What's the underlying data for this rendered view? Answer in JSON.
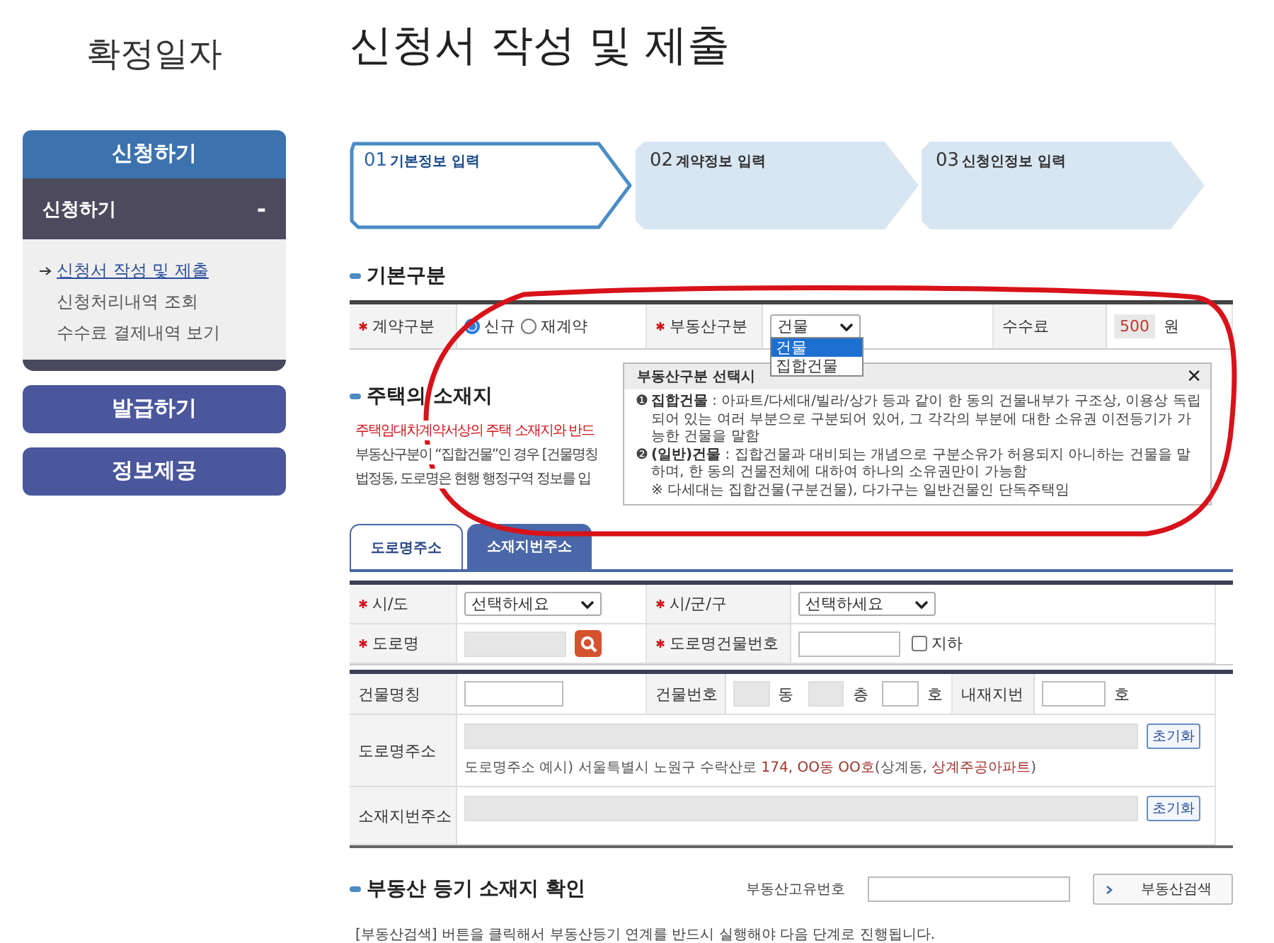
{
  "sidebar": {
    "title": "확정일자",
    "menus": [
      {
        "label": "신청하기",
        "selected": true,
        "expanded": true,
        "submenu": {
          "label": "신청하기",
          "toggle": "-",
          "items": [
            {
              "label": "신청서 작성 및 제출",
              "selected": true
            },
            {
              "label": "신청처리내역 조회",
              "selected": false
            },
            {
              "label": "수수료 결제내역 보기",
              "selected": false
            }
          ]
        }
      },
      {
        "label": "발급하기",
        "selected": false,
        "expanded": false
      },
      {
        "label": "정보제공",
        "selected": false,
        "expanded": false
      }
    ]
  },
  "page_title": "신청서 작성 및 제출",
  "steps": [
    {
      "number": "01",
      "label": "기본정보 입력",
      "selected": true
    },
    {
      "number": "02",
      "label": "계약정보 입력",
      "selected": false
    },
    {
      "number": "03",
      "label": "신청인정보 입력",
      "selected": false
    }
  ],
  "basic_section": {
    "title": "기본구분",
    "contract_type": {
      "label": "계약구분",
      "required": true,
      "options": [
        {
          "label": "신규",
          "selected": true
        },
        {
          "label": "재계약",
          "selected": false
        }
      ]
    },
    "property_type": {
      "label": "부동산구분",
      "required": true,
      "value": "건물",
      "expanded": true,
      "options": [
        {
          "label": "건물",
          "selected": true
        },
        {
          "label": "집합건물",
          "selected": false
        }
      ]
    },
    "fee": {
      "label": "수수료",
      "value": "500",
      "unit": "원"
    }
  },
  "popup": {
    "title": "부동산구분 선택시",
    "close": "✕",
    "items": [
      {
        "marker": "❶",
        "text": "**집합건물** : 아파트/다세대/빌라/상가 등과 같이 한 동의 건물내부가 구조상, 이용상 독립되어 있는 여러 부분으로 구분되어 있어, 그 각각의 부분에 대한 소유권 이전등기가 가능한 건물을 말함"
      },
      {
        "marker": "❷",
        "text": "**(일반)건물** : 집합건물과 대비되는 개념으로 구분소유가 허용되지 아니하는 건물을 말하며, 한 동의 건물전체에 대하여 하나의 소유권만이 가능함"
      }
    ],
    "note": "※ 다세대는 집합건물(구분건물), 다가구는 일반건물인 단독주택임"
  },
  "location_section": {
    "title": "주택의 소재지",
    "notes": [
      {
        "kind": "warning",
        "text": "주택임대차계약서상의 주택 소재지와 반드"
      },
      {
        "kind": "normal",
        "text": "부동산구분이 “집합건물”인 경우 [건물명칭"
      },
      {
        "kind": "normal",
        "text": "법정동, 도로명은 현행 행정구역 정보를 입"
      }
    ]
  },
  "address_tabs": [
    {
      "label": "도로명주소",
      "selected": true
    },
    {
      "label": "소재지번주소",
      "selected": false
    }
  ],
  "address_form": {
    "sido": {
      "label": "시/도",
      "required": true,
      "value": "선택하세요"
    },
    "sigungu": {
      "label": "시/군/구",
      "required": true,
      "value": "선택하세요"
    },
    "road_name": {
      "label": "도로명",
      "required": true
    },
    "road_building_no": {
      "label": "도로명건물번호",
      "required": true,
      "basement": {
        "label": "지하",
        "checked": false
      }
    },
    "building_name": {
      "label": "건물명칭"
    },
    "building_no": {
      "label": "건물번호",
      "units": [
        "동",
        "층",
        "호"
      ]
    },
    "inner_lot": {
      "label": "내재지번",
      "unit": "호"
    },
    "road_address": {
      "label": "도로명주소",
      "button": "초기화",
      "example": "도로명주소 예시) 서울특별시 노원구 수락산로 **174, OO동 OO호**(상계동, **상계주공아파트**)"
    },
    "lot_address": {
      "label": "소재지번주소",
      "button": "초기화"
    }
  },
  "registry_section": {
    "title": "부동산 등기 소재지 확인",
    "field_label": "부동산고유번호",
    "button": "부동산검색",
    "notes": [
      "[부동산검색] 버튼을 클릭해서 부동산등기 연계를 반드시 실행해야 다음 단계로 진행됩니다."
    ]
  }
}
